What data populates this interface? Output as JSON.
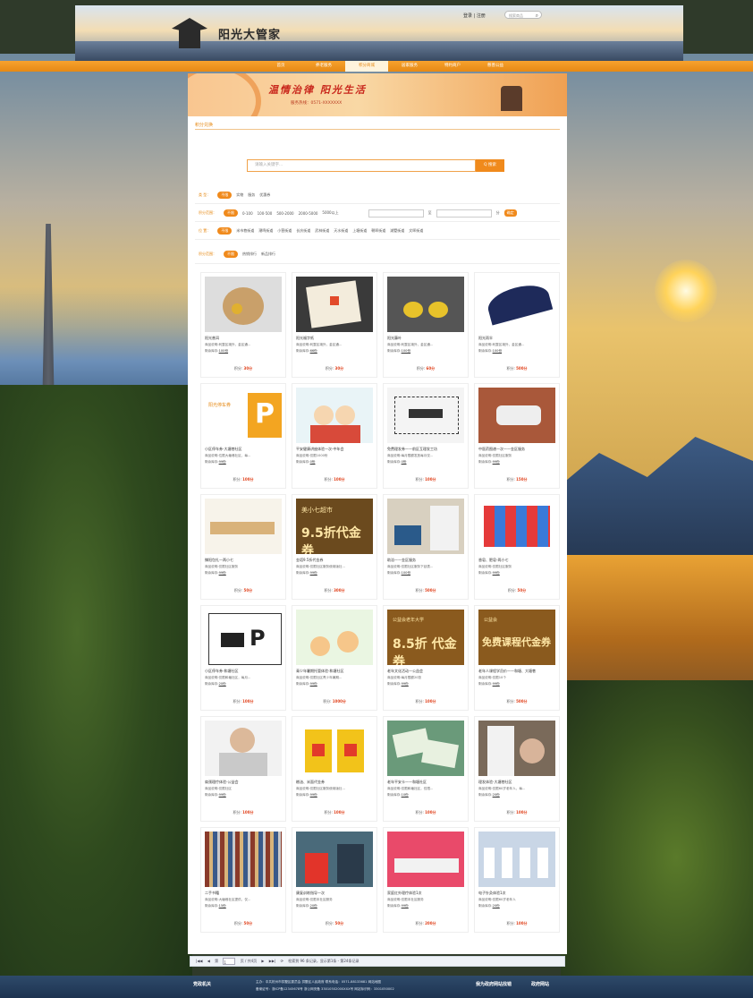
{
  "site": {
    "logo": "阳光大管家"
  },
  "header": {
    "login": "登录 | 注册",
    "search_placeholder": "搜索商品"
  },
  "nav": [
    "首页",
    "养老服务",
    "积分商城",
    "居家服务",
    "特约商户",
    "慈善公益"
  ],
  "banner": {
    "title": "温情治律  阳光生活",
    "phone": "服务热线：0571-XXXXXXX"
  },
  "section": {
    "label": "积分兑换"
  },
  "search": {
    "placeholder": "请输入关键字...",
    "button": "Q 搜索"
  },
  "filters": {
    "type": {
      "label": "类    型：",
      "options": [
        "不限",
        "实物",
        "服务",
        "优惠券"
      ]
    },
    "points": {
      "label": "积分范围：",
      "options": [
        "不限",
        "0-100",
        "100-500",
        "500-2000",
        "2000-5000",
        "5000以上"
      ],
      "sep": "至",
      "unit": "分",
      "ok": "确定"
    },
    "location": {
      "label": "位    置：",
      "options": [
        "不限",
        "米市巷街道",
        "潮鸣街道",
        "小营街道",
        "长庆街道",
        "武林街道",
        "天水街道",
        "上塘街道",
        "朝晖街道",
        "湖墅街道",
        "文晖街道"
      ]
    },
    "sort": {
      "label": "积分范围：",
      "options": [
        "不限",
        "热销排行",
        "新品排行"
      ]
    }
  },
  "products": [
    {
      "name": "阳光普洱",
      "desc": "商品说明:利整区境外，金区通...",
      "stock": "100份",
      "points": "30分",
      "thumb": "tea"
    },
    {
      "name": "阳光福字纸",
      "desc": "商品说明:利整区境外，金区通...",
      "stock": "66份",
      "points": "30分",
      "thumb": "paper"
    },
    {
      "name": "阳光藤叶",
      "desc": "商品说明:利整区境外，金区通...",
      "stock": "100份",
      "points": "60分",
      "thumb": "disc"
    },
    {
      "name": "阳光雨伞",
      "desc": "商品说明:利整区境外，金区通...",
      "stock": "100份",
      "points": "500分",
      "thumb": "umbrella"
    },
    {
      "name": "小区停车券-大塘巷社区",
      "desc": "商品说明:位限大塘巷社区，每...",
      "stock": "99份",
      "points": "100分",
      "thumb": "parking"
    },
    {
      "name": "平安健康讲座体验一次-中年会",
      "desc": "商品说明:仅限1000份",
      "stock": "0份",
      "points": "100分",
      "thumb": "cartoon"
    },
    {
      "name": "免费理发券——前区互理发工坊",
      "desc": "商品说明:每月限额发放每月仅...",
      "stock": "0份",
      "points": "100分",
      "thumb": "coupon"
    },
    {
      "name": "中医药图谱一次——金区服务",
      "desc": "商品说明:仅限社区服务",
      "stock": "99份",
      "points": "150分",
      "thumb": "device"
    },
    {
      "name": "撑阳包扎—两小七",
      "desc": "商品说明:仅限社区服务",
      "stock": "99份",
      "points": "50分",
      "thumb": "snack"
    },
    {
      "name": "金塔9.5折代金券",
      "desc": "商品说明:仅限社区服务使用版社...",
      "stock": "99份",
      "points": "300分",
      "thumb": "v95"
    },
    {
      "name": "助浴——金区服务",
      "desc": "商品说明:仅限社区服务下延表...",
      "stock": "100份",
      "points": "500分",
      "thumb": "bath"
    },
    {
      "name": "香皂、肥皂-两小七",
      "desc": "商品说明:仅限社区服务",
      "stock": "99份",
      "points": "50分",
      "thumb": "soap"
    },
    {
      "name": "小区停车券-和塘社区",
      "desc": "商品说明:仅限和塘社区，每月...",
      "stock": "20份",
      "points": "100分",
      "thumb": "ticket"
    },
    {
      "name": "青少年暑期托管体验-和塘社区",
      "desc": "商品说明:仅限社区青少年暑期...",
      "stock": "99份",
      "points": "1000分",
      "thumb": "kids"
    },
    {
      "name": "老年文化活动—公益会",
      "desc": "商品说明:每月限额20张",
      "stock": "99份",
      "points": "100分",
      "thumb": "v85"
    },
    {
      "name": "老年人课程学员价——和塘、大塘巷",
      "desc": "商品说明:仅限10个",
      "stock": "99份",
      "points": "500分",
      "thumb": "course"
    },
    {
      "name": "肩颈理疗体验-公益会",
      "desc": "商品说明:仅限社区",
      "stock": "99份",
      "points": "100分",
      "thumb": "massage"
    },
    {
      "name": "粮油、米面代金券",
      "desc": "商品说明:仅限社区服务使用版社...",
      "stock": "99份",
      "points": "100分",
      "thumb": "oil"
    },
    {
      "name": "老年平安卡——和塘社区",
      "desc": "商品说明:仅限和塘社区，仅限...",
      "stock": "10份",
      "points": "100分",
      "thumb": "card"
    },
    {
      "name": "理发体验-大塘巷社区",
      "desc": "商品说明:仅限60岁老年人，每...",
      "stock": "20份",
      "points": "100分",
      "thumb": "haircut"
    },
    {
      "name": "二手书籍",
      "desc": "商品说明:大塘巷社区提供，仅...",
      "stock": "15份",
      "points": "50分",
      "thumb": "books"
    },
    {
      "name": "康复训练指导一次",
      "desc": "商品说明:仅限本社区服务",
      "stock": "20份",
      "points": "50分",
      "thumb": "rehab"
    },
    {
      "name": "家庭红外理疗体验1次",
      "desc": "商品说明:仅限本社区服务",
      "stock": "99份",
      "points": "200分",
      "thumb": "therapy"
    },
    {
      "name": "电子针灸体验1次",
      "desc": "商品说明:仅限60岁老年人",
      "stock": "20份",
      "points": "100分",
      "thumb": "clinic"
    }
  ],
  "product_labels": {
    "stock": "剩余库存:",
    "points": "积分:"
  },
  "pager": {
    "first": "|◀◀",
    "prev": "◀",
    "page_label": "第",
    "page_value": "1",
    "page_total": "页 / 共4页",
    "next": "▶",
    "last": "▶▶|",
    "refresh": "⟳",
    "summary": "检索到 96 条记录，显示第1条 - 第24条记录"
  },
  "footer": {
    "line1": "主办：中共杭州市拱墅区委员会 拱墅区人民政府 联系电话：0571-88133681 网站地图",
    "line2": "备案证号：浙ICP备12345678号  浙公网安备 33010502000XXX号 网站标识码：3301050002",
    "badge1": "党政机关",
    "badge2": "我为政府网站找错",
    "badge3": "政府网站"
  },
  "colors": {
    "accent": "#f08a1c",
    "price": "#e0411b",
    "footer": "#1d3350"
  }
}
